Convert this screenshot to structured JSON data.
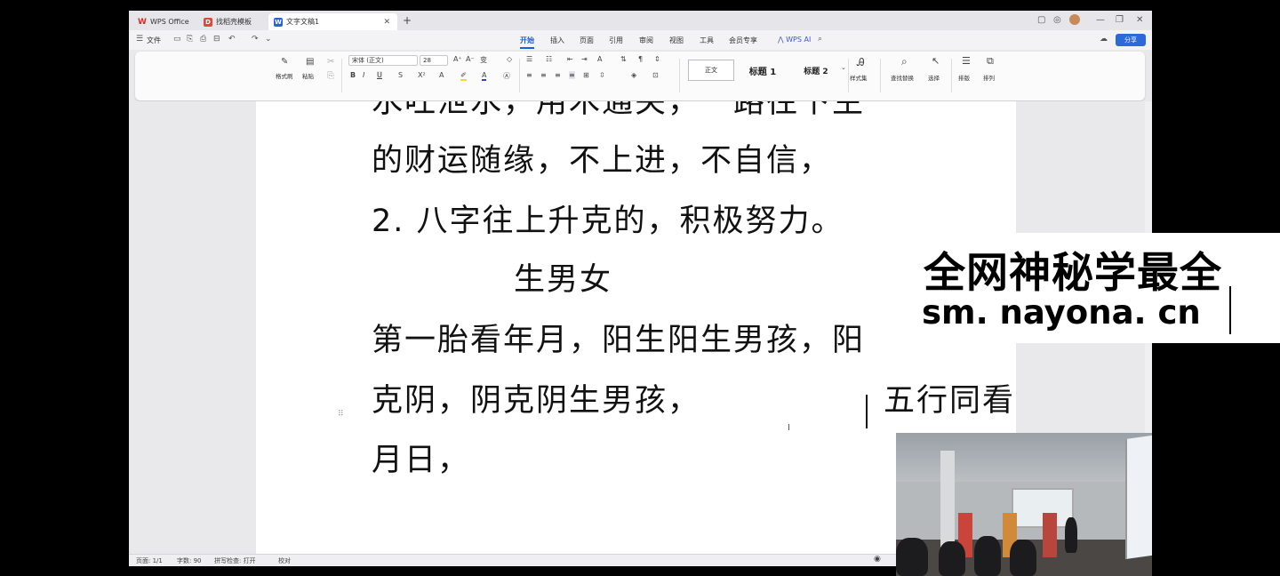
{
  "tabs": {
    "wps": "WPS Office",
    "template": "找稻壳模板",
    "doc": "文字文稿1",
    "new": "+"
  },
  "menu": {
    "file": "文件",
    "items": [
      "开始",
      "插入",
      "页面",
      "引用",
      "审阅",
      "视图",
      "工具",
      "会员专享"
    ],
    "wps_ai": "WPS AI",
    "share": "分享"
  },
  "ribbon": {
    "format_painter": "格式刷",
    "paste": "粘贴",
    "font_name": "宋体 (正文)",
    "font_size": "28",
    "style_normal": "正文",
    "style_h1": "标题 1",
    "style_h2": "标题 2",
    "style_set": "样式集",
    "find_replace": "查找替换",
    "select": "选择",
    "layout": "排版",
    "arrange": "排列"
  },
  "document": {
    "lines": [
      "水吐泄水，用木通关，一路往下生",
      "的财运随缘，不上进，不自信，",
      "2. 八字往上升克的，积极努力。",
      "生男女",
      "第一胎看年月，阳生阳生男孩，阳",
      "克阴，阴克阴生男孩，",
      "五行同看",
      "月日，"
    ]
  },
  "status": {
    "page": "页面: 1/1",
    "words": "字数: 90",
    "spell": "拼写检查: 打开",
    "proof": "校对"
  },
  "watermark": {
    "line1": "全网神秘学最全",
    "line2": "sm. nayona. cn"
  },
  "colors": {
    "accent": "#1f5fd6",
    "page": "#ffffff",
    "background": "#000000"
  }
}
